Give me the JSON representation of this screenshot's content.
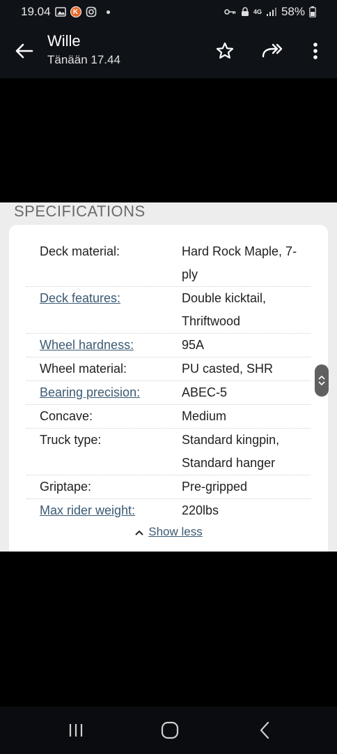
{
  "status_bar": {
    "time": "19.04",
    "battery": "58%",
    "network": "4G"
  },
  "header": {
    "sender": "Wille",
    "timestamp": "Tänään 17.44"
  },
  "specifications": {
    "heading": "SPECIFICATIONS",
    "rows": [
      {
        "label": "Deck material:",
        "value_lines": [
          "Hard Rock Maple, 7-",
          "ply"
        ],
        "link": false
      },
      {
        "label": "Deck features:",
        "value_lines": [
          "Double kicktail,",
          "Thriftwood"
        ],
        "link": true
      },
      {
        "label": "Wheel hardness:",
        "value_lines": [
          "95A"
        ],
        "link": true
      },
      {
        "label": "Wheel material:",
        "value_lines": [
          "PU casted, SHR"
        ],
        "link": false
      },
      {
        "label": "Bearing precision:",
        "value_lines": [
          "ABEC-5"
        ],
        "link": true
      },
      {
        "label": "Concave:",
        "value_lines": [
          "Medium"
        ],
        "link": false
      },
      {
        "label": "Truck type:",
        "value_lines": [
          "Standard kingpin,",
          "Standard hanger"
        ],
        "link": false
      },
      {
        "label": "Griptape:",
        "value_lines": [
          "Pre-gripped"
        ],
        "link": false
      },
      {
        "label": "Max rider weight:",
        "value_lines": [
          "220lbs"
        ],
        "link": true
      }
    ],
    "show_less": "Show less"
  },
  "icons": {
    "back": "arrow-left-icon",
    "star": "star-outline-icon",
    "forward": "forward-all-icon",
    "more": "more-vertical-icon"
  }
}
